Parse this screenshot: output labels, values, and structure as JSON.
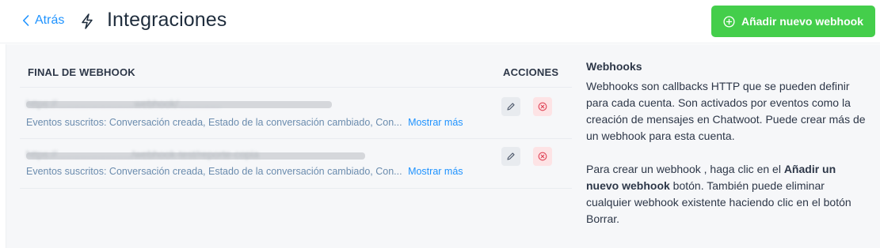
{
  "header": {
    "back_label": "Atrás",
    "title": "Integraciones",
    "add_button_label": "Añadir nuevo webhook"
  },
  "table": {
    "col_endpoint": "FINAL DE WEBHOOK",
    "col_actions": "ACCIONES",
    "rows": [
      {
        "url": "https://...........................webhook/...............",
        "events_label": "Eventos suscritos:",
        "events_value": "Conversación creada, Estado de la conversación cambiado, Con...",
        "show_more": "Mostrar más"
      },
      {
        "url": "https://........................../webhook-test/reporte-copia",
        "events_label": "Eventos suscritos:",
        "events_value": "Conversación creada, Estado de la conversación cambiado, Con...",
        "show_more": "Mostrar más"
      }
    ]
  },
  "sidebar": {
    "title": "Webhooks",
    "paragraph1": "Webhooks son callbacks HTTP que se pueden definir para cada cuenta. Son activados por eventos como la creación de mensajes en Chatwoot. Puede crear más de un webhook para esta cuenta.",
    "p2_before": "Para crear un webhook , haga clic en el ",
    "p2_bold": "Añadir un nuevo webhook",
    "p2_after": " botón. También puede eliminar cualquier webhook existente haciendo clic en el botón Borrar."
  },
  "colors": {
    "accent": "#1f93ff",
    "add_button": "#44ce4b",
    "delete_bg": "#fde3e5",
    "delete_icon": "#e0485a"
  }
}
